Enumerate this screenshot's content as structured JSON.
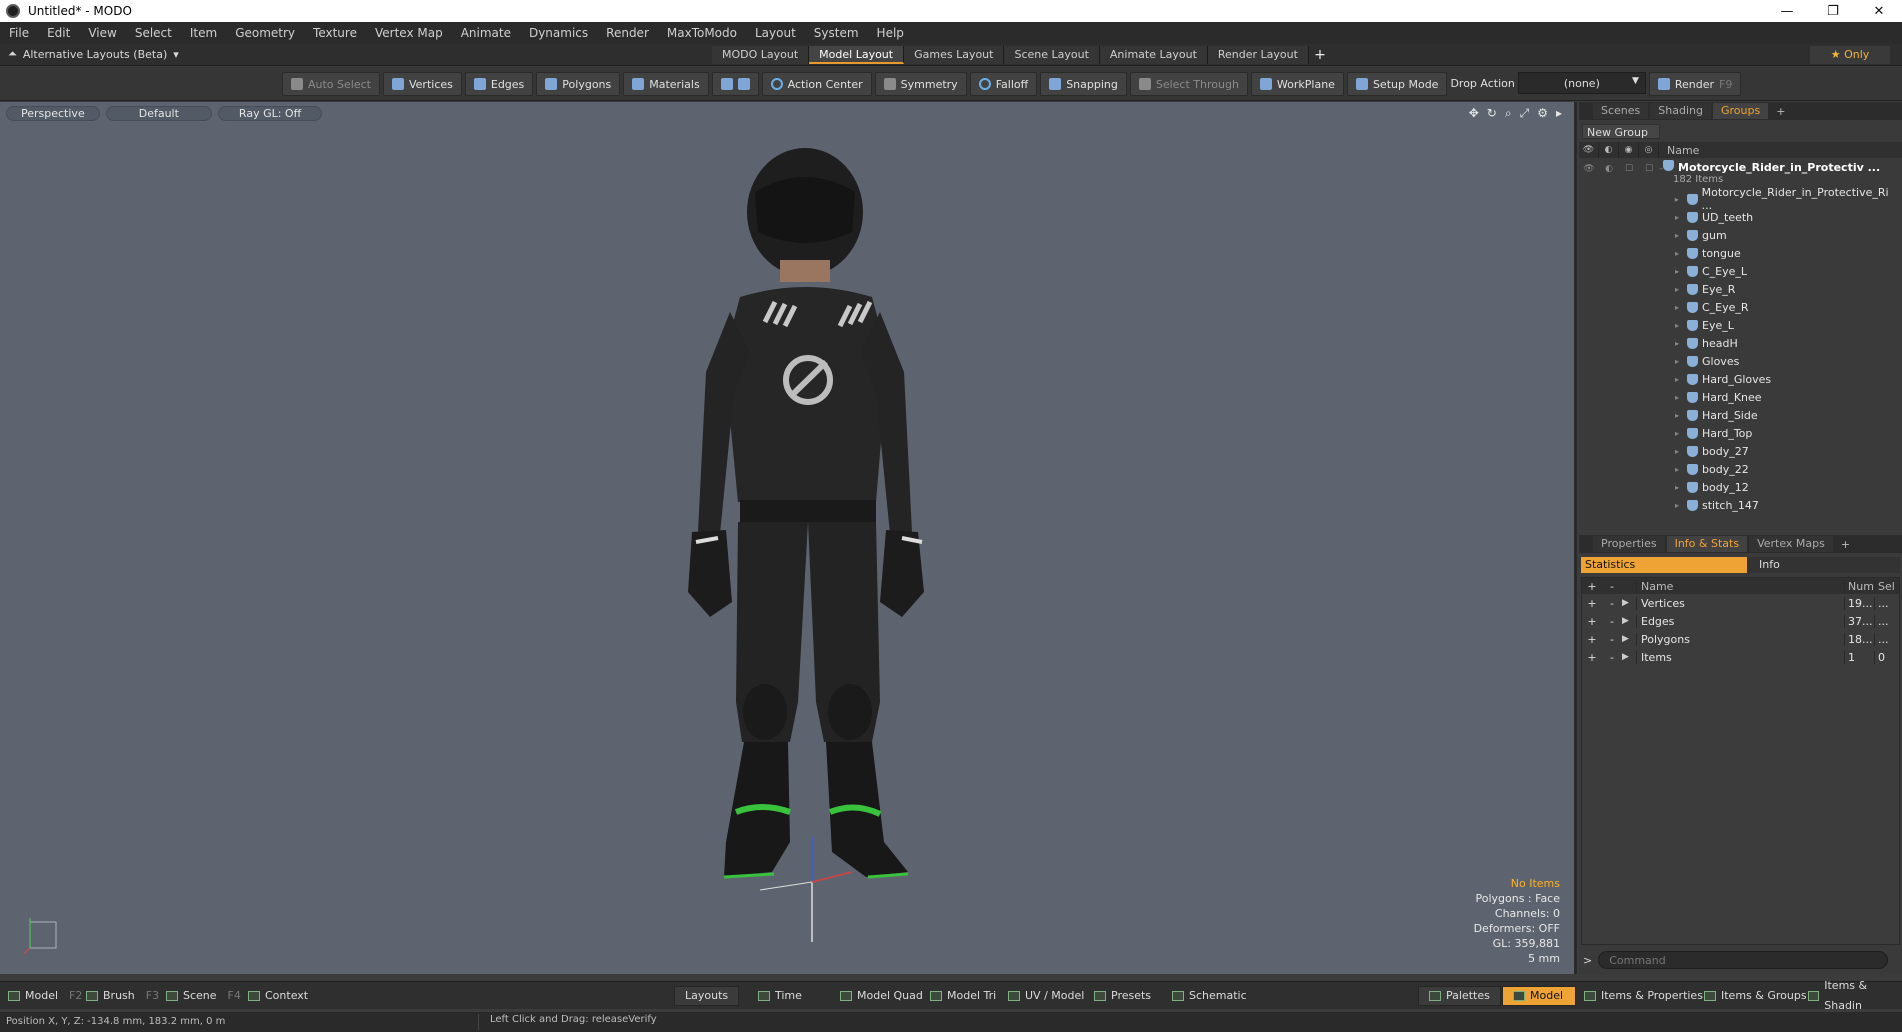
{
  "window": {
    "title": "Untitled* - MODO",
    "controls": [
      "—",
      "❐",
      "✕"
    ]
  },
  "menu": [
    "File",
    "Edit",
    "View",
    "Select",
    "Item",
    "Geometry",
    "Texture",
    "Vertex Map",
    "Animate",
    "Dynamics",
    "Render",
    "MaxToModo",
    "Layout",
    "System",
    "Help"
  ],
  "layoutbar": {
    "alt_layouts": "Alternative Layouts (Beta)",
    "tabs": [
      "MODO Layout",
      "Model Layout",
      "Games Layout",
      "Scene Layout",
      "Animate Layout",
      "Render Layout"
    ],
    "active_tab": "Model Layout",
    "add": "+",
    "only": "★ Only"
  },
  "toolbar": {
    "auto_select": "Auto Select",
    "vertices": "Vertices",
    "edges": "Edges",
    "polygons": "Polygons",
    "materials": "Materials",
    "action_center": "Action Center",
    "symmetry": "Symmetry",
    "falloff": "Falloff",
    "snapping": "Snapping",
    "select_through": "Select Through",
    "workplane": "WorkPlane",
    "setup_mode": "Setup Mode",
    "drop_action": "Drop Action",
    "drop_value": "(none)",
    "render": "Render",
    "render_key": "F9"
  },
  "viewport": {
    "view": "Perspective",
    "shading": "Default",
    "raygl": "Ray GL: Off",
    "info": {
      "no_items": "No Items",
      "polygons": "Polygons : Face",
      "channels": "Channels: 0",
      "deformers": "Deformers: OFF",
      "gl": "GL: 359,881",
      "scale": "5 mm"
    }
  },
  "groups_panel": {
    "tabs": [
      "Scenes",
      "Shading",
      "Groups"
    ],
    "active_tab": "Groups",
    "new_group": "New Group",
    "name_header": "Name",
    "group_name": "Motorcycle_Rider_in_Protectiv ...",
    "group_count": "182 Items",
    "items": [
      "Motorcycle_Rider_in_Protective_Ri ...",
      "UD_teeth",
      "gum",
      "tongue",
      "C_Eye_L",
      "Eye_R",
      "C_Eye_R",
      "Eye_L",
      "headH",
      "Gloves",
      "Hard_Gloves",
      "Hard_Knee",
      "Hard_Side",
      "Hard_Top",
      "body_27",
      "body_22",
      "body_12",
      "stitch_147"
    ]
  },
  "stats_panel": {
    "tabs": [
      "Properties",
      "Info & Stats",
      "Vertex Maps"
    ],
    "active_tab": "Info & Stats",
    "sub_tabs": [
      "Statistics",
      "Info"
    ],
    "headers": {
      "name": "Name",
      "num": "Num",
      "sel": "Sel"
    },
    "rows": [
      {
        "name": "Vertices",
        "num": "19...",
        "sel": "..."
      },
      {
        "name": "Edges",
        "num": "37...",
        "sel": "..."
      },
      {
        "name": "Polygons",
        "num": "18...",
        "sel": "..."
      },
      {
        "name": "Items",
        "num": "1",
        "sel": "0"
      }
    ],
    "command_placeholder": "Command"
  },
  "bottombar": {
    "model": "Model",
    "model_key": "F2",
    "brush": "Brush",
    "brush_key": "F3",
    "scene": "Scene",
    "scene_key": "F4",
    "context": "Context",
    "layouts": "Layouts",
    "time": "Time",
    "model_quad": "Model Quad",
    "model_tri": "Model Tri",
    "uv_model": "UV / Model",
    "presets": "Presets",
    "schematic": "Schematic",
    "palettes": "Palettes",
    "model_right": "Model",
    "items_properties": "Items & Properties",
    "items_groups": "Items & Groups",
    "items_shading": "Items & Shadin"
  },
  "statusbar": {
    "position": "Position X, Y, Z:  -134.8 mm, 183.2 mm, 0 m",
    "hint": "Left Click and Drag:  releaseVerify"
  }
}
